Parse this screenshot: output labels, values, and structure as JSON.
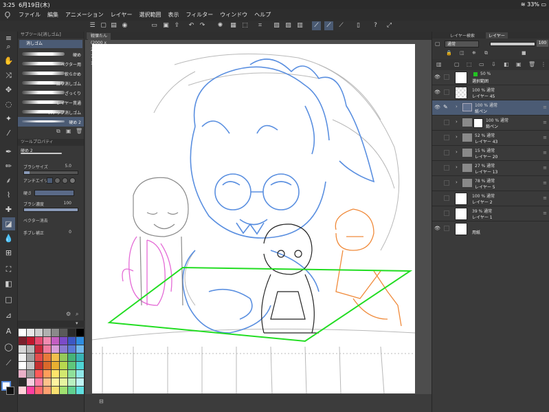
{
  "status": {
    "time": "3:25",
    "date": "6月19日(木)",
    "battery": "33%"
  },
  "menu": [
    "ファイル",
    "編集",
    "アニメーション",
    "レイヤー",
    "選択範囲",
    "表示",
    "フィルター",
    "ウィンドウ",
    "ヘルプ"
  ],
  "subtool": {
    "header": "サブツール[消しゴム]",
    "group": "消しゴム",
    "brushes": [
      {
        "label": "硬め"
      },
      {
        "label": "ベクター用"
      },
      {
        "label": "軟らかめ"
      },
      {
        "label": "練り消しゴム"
      },
      {
        "label": "ざっくり"
      },
      {
        "label": "レイヤー貫通"
      },
      {
        "label": "スナップ消しゴム"
      },
      {
        "label": "硬め 2"
      }
    ]
  },
  "toolprop": {
    "header": "ツールプロパティ",
    "preset": "硬め 2",
    "brush_size_label": "ブラシサイズ",
    "brush_size": "5.0",
    "antialias_label": "アンチエイリ",
    "hardness_label": "硬さ",
    "density_label": "ブラシ濃度",
    "density": "100",
    "vector_erase_label": "ベクター消去",
    "stabilization_label": "手ブレ補正",
    "stabilization": "0"
  },
  "palette_colors": [
    "#ffffff",
    "#e8e8e8",
    "#cfcfcf",
    "#b0b0b0",
    "#8a8a8a",
    "#5a5a5a",
    "#2a2a2a",
    "#000000",
    "#7a1f2b",
    "#c0182e",
    "#e74a6f",
    "#f28ab0",
    "#c45ec2",
    "#7b4bc9",
    "#3d57c4",
    "#2f8de0",
    "#d6d6d6",
    "#b8b8b8",
    "#c92a3a",
    "#f07b9d",
    "#d79ed9",
    "#8a7ad1",
    "#5a79d6",
    "#71b8ec",
    "#f0f0f0",
    "#a0a0a0",
    "#e34b4b",
    "#e87a3a",
    "#f2c04d",
    "#96c95a",
    "#45b378",
    "#39b5b5",
    "#ffffff",
    "#c8c8c8",
    "#c43131",
    "#d9692b",
    "#e8b032",
    "#b8d84f",
    "#5fc77b",
    "#4fd4d4",
    "#e9b0c8",
    "#9a9a9a",
    "#ff5a5a",
    "#ff9d5a",
    "#ffe46b",
    "#d3e86f",
    "#8fe09a",
    "#8fe8e8",
    "#2a2a2a",
    "#f5d0e0",
    "#ff7fa8",
    "#ffc18a",
    "#fff3a0",
    "#e6f5a0",
    "#b8f0c0",
    "#c0f5f5",
    "#ffd0d8",
    "#ff3fa0",
    "#ff6a6a",
    "#ffa070",
    "#f8e070",
    "#a0e070",
    "#60d090",
    "#60e0e0"
  ],
  "canvas": {
    "tab_title": "戦慄たん (2000 x 2000px 72dpi 112.2%)"
  },
  "layer_panel": {
    "tab_props": "レイヤー検索",
    "tab_layer": "レイヤー",
    "blend_mode": "通常",
    "opacity": "100",
    "layers": [
      {
        "line1": "50 %",
        "line2": "選択範囲",
        "type": "selection"
      },
      {
        "line1": "100 % 通常",
        "line2": "レイヤー 45",
        "type": "raster"
      },
      {
        "line1": "100 % 通常",
        "line2": "紙ペン",
        "type": "folder",
        "selected": true
      },
      {
        "line1": "100 % 通常",
        "line2": "鉛ペン",
        "type": "folder"
      },
      {
        "line1": "52 % 通常",
        "line2": "レイヤー 43",
        "type": "folder"
      },
      {
        "line1": "15 % 通常",
        "line2": "レイヤー 20",
        "type": "folder"
      },
      {
        "line1": "27 % 通常",
        "line2": "レイヤー 13",
        "type": "folder"
      },
      {
        "line1": "78 % 通常",
        "line2": "レイヤー 5",
        "type": "folder"
      },
      {
        "line1": "100 % 通常",
        "line2": "レイヤー 2",
        "type": "raster"
      },
      {
        "line1": "39 % 通常",
        "line2": "レイヤー 1",
        "type": "raster"
      },
      {
        "line1": "",
        "line2": "用紙",
        "type": "paper"
      }
    ]
  },
  "colors": {
    "accent": "#4b5b74",
    "perspective_green": "#22dd22",
    "sketch_blue": "#5a8fe0",
    "sketch_pink": "#e46ad6",
    "sketch_orange": "#f08a3a",
    "sketch_gray": "#9a9a9a"
  }
}
